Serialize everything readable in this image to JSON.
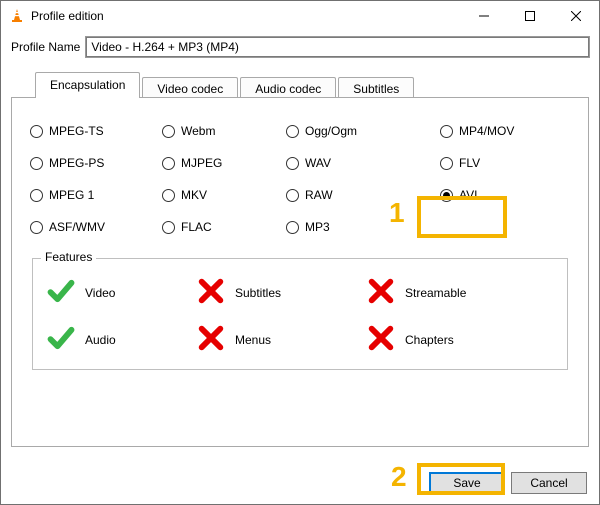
{
  "window": {
    "title": "Profile edition"
  },
  "profile": {
    "label": "Profile Name",
    "value": "Video - H.264 + MP3 (MP4)"
  },
  "tabs": [
    {
      "label": "Encapsulation",
      "active": true
    },
    {
      "label": "Video codec",
      "active": false
    },
    {
      "label": "Audio codec",
      "active": false
    },
    {
      "label": "Subtitles",
      "active": false
    }
  ],
  "encapsulation": {
    "selected": "AVI",
    "options": [
      "MPEG-TS",
      "Webm",
      "Ogg/Ogm",
      "MP4/MOV",
      "MPEG-PS",
      "MJPEG",
      "WAV",
      "FLV",
      "MPEG 1",
      "MKV",
      "RAW",
      "AVI",
      "ASF/WMV",
      "FLAC",
      "MP3"
    ]
  },
  "features": {
    "legend": "Features",
    "items": [
      {
        "name": "Video",
        "ok": true
      },
      {
        "name": "Subtitles",
        "ok": false
      },
      {
        "name": "Streamable",
        "ok": false
      },
      {
        "name": "Audio",
        "ok": true
      },
      {
        "name": "Menus",
        "ok": false
      },
      {
        "name": "Chapters",
        "ok": false
      }
    ]
  },
  "buttons": {
    "save": "Save",
    "cancel": "Cancel"
  },
  "annotations": {
    "n1": "1",
    "n2": "2"
  }
}
